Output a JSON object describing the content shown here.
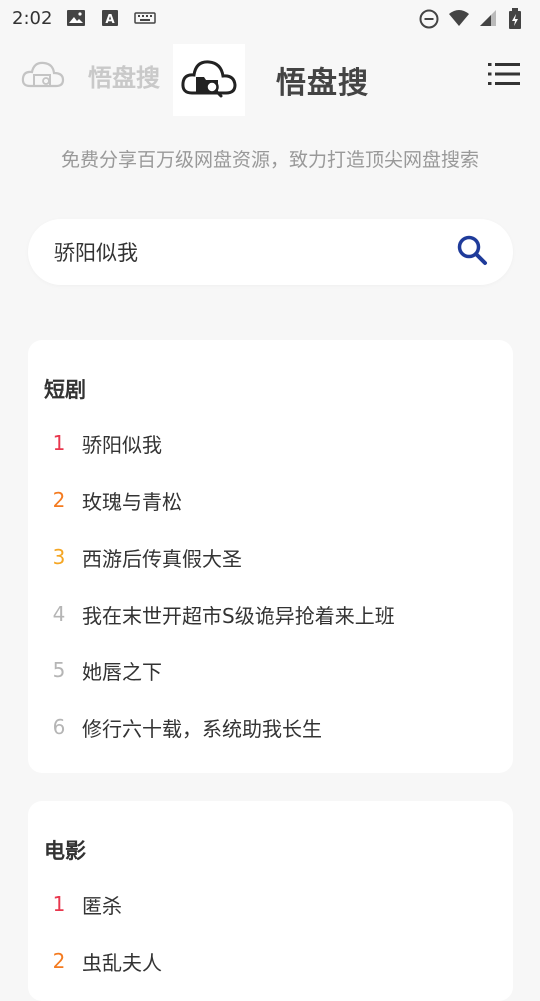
{
  "status_bar": {
    "time": "2:02",
    "left_icons": [
      "image-icon",
      "a-keyboard-icon",
      "keyboard-icon"
    ],
    "right_icons": [
      "dnd-icon",
      "wifi-icon",
      "signal-icon",
      "battery-icon"
    ]
  },
  "header": {
    "title": "悟盘搜",
    "ghost_title": "悟盘搜",
    "logo_icon": "cloud-folder-search-icon",
    "menu_icon": "menu-list-icon"
  },
  "tagline": "免费分享百万级网盘资源，致力打造顶尖网盘搜索",
  "search": {
    "value": "骄阳似我",
    "icon": "search-icon",
    "accent": "#1f3b9a"
  },
  "rank_colors": [
    "#e8374d",
    "#f47b20",
    "#f5a623",
    "#b5b5b5",
    "#b5b5b5",
    "#b5b5b5"
  ],
  "sections": [
    {
      "title": "短剧",
      "items": [
        {
          "rank": "1",
          "label": "骄阳似我"
        },
        {
          "rank": "2",
          "label": "玫瑰与青松"
        },
        {
          "rank": "3",
          "label": "西游后传真假大圣"
        },
        {
          "rank": "4",
          "label": "我在末世开超市S级诡异抢着来上班"
        },
        {
          "rank": "5",
          "label": "她唇之下"
        },
        {
          "rank": "6",
          "label": "修行六十载，系统助我长生"
        }
      ]
    },
    {
      "title": "电影",
      "items": [
        {
          "rank": "1",
          "label": "匿杀"
        },
        {
          "rank": "2",
          "label": "虫乱夫人"
        }
      ]
    }
  ]
}
